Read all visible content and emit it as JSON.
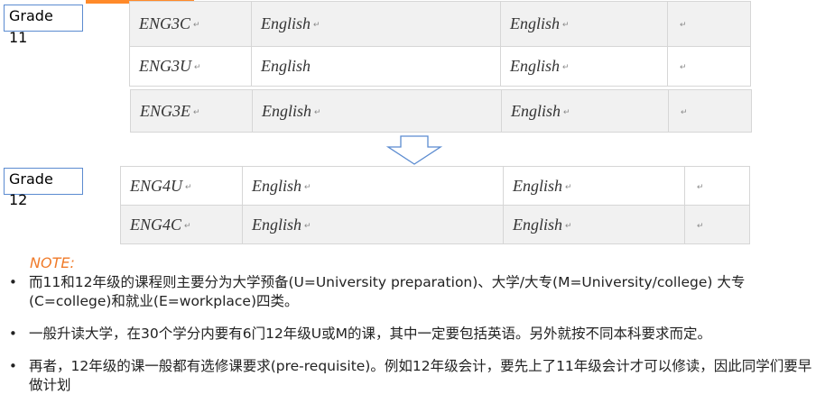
{
  "grade11": {
    "label": "Grade",
    "year": "11"
  },
  "grade12": {
    "label": "Grade",
    "year": "12"
  },
  "table11": [
    {
      "code": "ENG3C",
      "subject": "English",
      "subject2": "English"
    },
    {
      "code": "ENG3U",
      "subject": "English",
      "subject2": "English"
    },
    {
      "code": "ENG3E",
      "subject": "English",
      "subject2": "English"
    }
  ],
  "table12": [
    {
      "code": "ENG4U",
      "subject": "English",
      "subject2": "English"
    },
    {
      "code": "ENG4C",
      "subject": "English",
      "subject2": "English"
    }
  ],
  "cell_mark": "↵",
  "note_label": "NOTE:",
  "bullets": [
    "而11和12年级的课程则主要分为大学预备(U=University preparation)、大学/大专(M=University/college) 大专(C=college)和就业(E=workplace)四类。",
    "一般升读大学，在30个学分内要有6门12年级U或M的课，其中一定要包括英语。另外就按不同本科要求而定。",
    "再者，12年级的课一般都有选修课要求(pre-requisite)。例如12年级会计，要先上了11年级会计才可以修读，因此同学们要早做计划"
  ],
  "colors": {
    "accent": "#f07b2a",
    "box_border": "#5b8bd0",
    "arrow": "#5b8bd0"
  }
}
